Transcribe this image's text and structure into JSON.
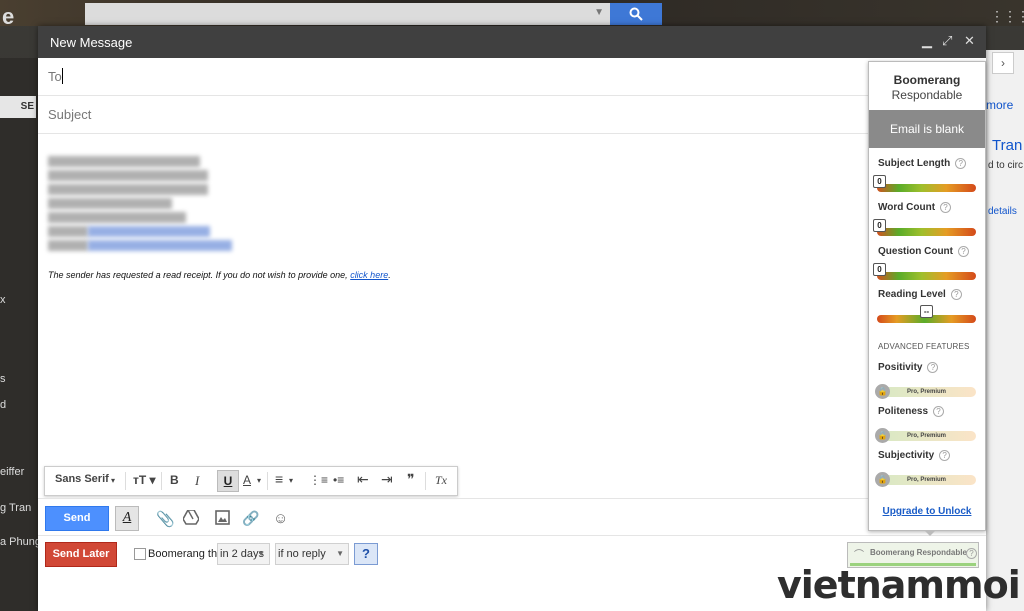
{
  "background": {
    "logo": "e",
    "grid_icon": "⋮⋮⋮",
    "left_items": [
      {
        "text": "SE"
      },
      {
        "text": "x"
      },
      {
        "text": "s"
      },
      {
        "text": "d"
      },
      {
        "text": "eiffer"
      },
      {
        "text": "g Tran"
      },
      {
        "text": "a Phung"
      }
    ],
    "right_items": {
      "more": "more",
      "name": "Tran",
      "sub": "d to circ",
      "details": "details"
    }
  },
  "compose": {
    "title": "New Message",
    "to_label": "To",
    "subject_label": "Subject",
    "receipt_text": "The sender has requested a read receipt. If you do not wish to provide one, ",
    "receipt_link": "click here",
    "receipt_end": ".",
    "toolbar": {
      "font": "Sans Serif",
      "font_chevron": "▾",
      "bold": "B",
      "italic": "I",
      "underline": "U",
      "text_color": "A",
      "align": "≡",
      "numbered": "⋮≡",
      "bulleted": "•≡",
      "indent_less": "⇤",
      "indent_more": "⇥",
      "quote": "❞",
      "remove_format": "Tx"
    },
    "send_label": "Send",
    "format_toggle": "A"
  },
  "boomerang": {
    "send_later": "Send Later",
    "boomerang_this": "Boomerang this",
    "delay": "in 2 days",
    "condition": "if no reply",
    "help": "?",
    "respondable_tab": "Boomerang Respondable"
  },
  "respondable": {
    "title": "Boomerang",
    "subtitle": "Respondable",
    "status": "Email is blank",
    "metrics": [
      {
        "label": "Subject Length",
        "value": "0",
        "position": 0
      },
      {
        "label": "Word Count",
        "value": "0",
        "position": 0
      },
      {
        "label": "Question Count",
        "value": "0",
        "position": 0
      },
      {
        "label": "Reading Level",
        "value": "--",
        "position": 0.5
      }
    ],
    "advanced_label": "ADVANCED FEATURES",
    "advanced": [
      {
        "label": "Positivity",
        "badge": "Pro, Premium"
      },
      {
        "label": "Politeness",
        "badge": "Pro, Premium"
      },
      {
        "label": "Subjectivity",
        "badge": "Pro, Premium"
      }
    ],
    "upgrade": "Upgrade to Unlock"
  },
  "watermark": "vietnammoi"
}
